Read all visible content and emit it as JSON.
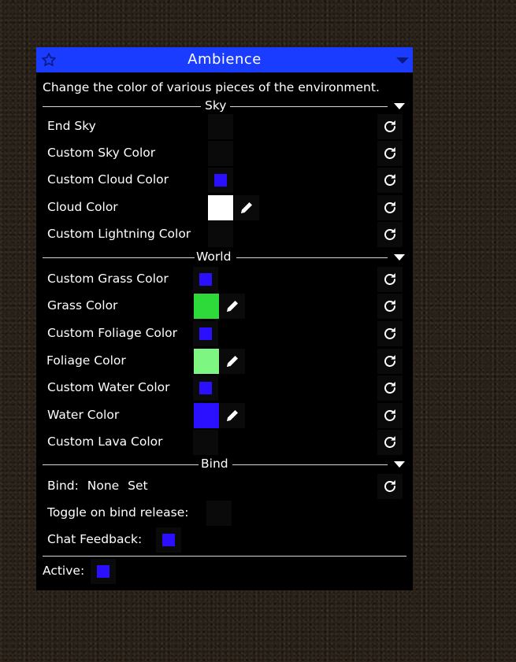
{
  "panel": {
    "title": "Ambience",
    "description": "Change the color of various pieces of the environment."
  },
  "sections": {
    "sky": "Sky",
    "world": "World",
    "bind": "Bind"
  },
  "sky": {
    "end_sky": {
      "label": "End Sky",
      "checked": false
    },
    "custom_sky_color": {
      "label": "Custom Sky Color",
      "checked": false
    },
    "custom_cloud_color": {
      "label": "Custom Cloud Color",
      "checked": true
    },
    "cloud_color": {
      "label": "Cloud Color",
      "color": "#ffffff"
    },
    "custom_lightning_color": {
      "label": "Custom Lightning Color",
      "checked": false
    }
  },
  "world": {
    "custom_grass_color": {
      "label": "Custom Grass Color",
      "checked": true
    },
    "grass_color": {
      "label": "Grass Color",
      "color": "#2ed93a"
    },
    "custom_foliage_color": {
      "label": "Custom Foliage Color",
      "checked": true
    },
    "foliage_color": {
      "label": "Foliage Color",
      "color": "#7ef782"
    },
    "custom_water_color": {
      "label": "Custom Water Color",
      "checked": true
    },
    "water_color": {
      "label": "Water Color",
      "color": "#2a10ff"
    },
    "custom_lava_color": {
      "label": "Custom Lava Color",
      "checked": false
    }
  },
  "bind": {
    "bind_label": "Bind:",
    "bind_value": "None",
    "set_label": "Set",
    "toggle_on_release": {
      "label": "Toggle on bind release:",
      "checked": false
    },
    "chat_feedback": {
      "label": "Chat Feedback:",
      "checked": true
    }
  },
  "active": {
    "label": "Active:",
    "checked": true
  },
  "colors": {
    "accent": "#1a3cff",
    "panel_bg": "#000000",
    "checkbox_on": "#2a10ff"
  },
  "icons": {
    "header_left": "star-icon",
    "header_right": "caret-down-icon",
    "reset": "reset-icon",
    "edit": "pencil-icon"
  }
}
